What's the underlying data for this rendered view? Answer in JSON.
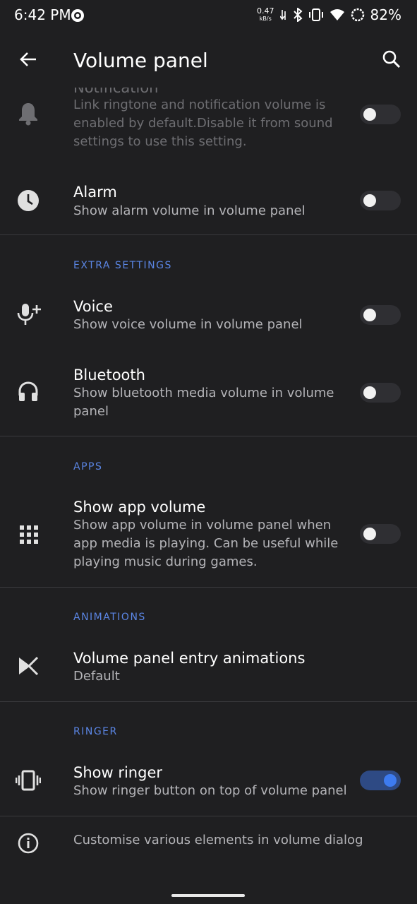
{
  "status_bar": {
    "time": "6:42 PM",
    "speed_value": "0.47",
    "speed_unit": "kB/s",
    "battery": "82%"
  },
  "toolbar": {
    "title": "Volume panel"
  },
  "items": {
    "notification": {
      "title": "Notification",
      "subtitle": "Link ringtone and notification volume is enabled by default.Disable it from sound settings to use this setting."
    },
    "alarm": {
      "title": "Alarm",
      "subtitle": "Show alarm volume in volume panel"
    },
    "voice": {
      "title": "Voice",
      "subtitle": "Show voice volume in volume panel"
    },
    "bluetooth": {
      "title": "Bluetooth",
      "subtitle": "Show bluetooth media volume in volume panel"
    },
    "app_volume": {
      "title": "Show app volume",
      "subtitle": "Show app volume in volume panel when app media is playing. Can be useful while playing music during games."
    },
    "animations": {
      "title": "Volume panel entry animations",
      "subtitle": "Default"
    },
    "ringer": {
      "title": "Show ringer",
      "subtitle": "Show ringer button on top of volume panel"
    },
    "info": {
      "text": "Customise various elements in volume dialog"
    }
  },
  "sections": {
    "extra": "EXTRA SETTINGS",
    "apps": "APPS",
    "animations": "ANIMATIONS",
    "ringer": "RINGER"
  },
  "toggles": {
    "notification": false,
    "alarm": false,
    "voice": false,
    "bluetooth": false,
    "app_volume": false,
    "ringer": true
  },
  "colors": {
    "background": "#1f1f21",
    "accent": "#5b86e5",
    "toggle_on": "#3d7bf0"
  }
}
